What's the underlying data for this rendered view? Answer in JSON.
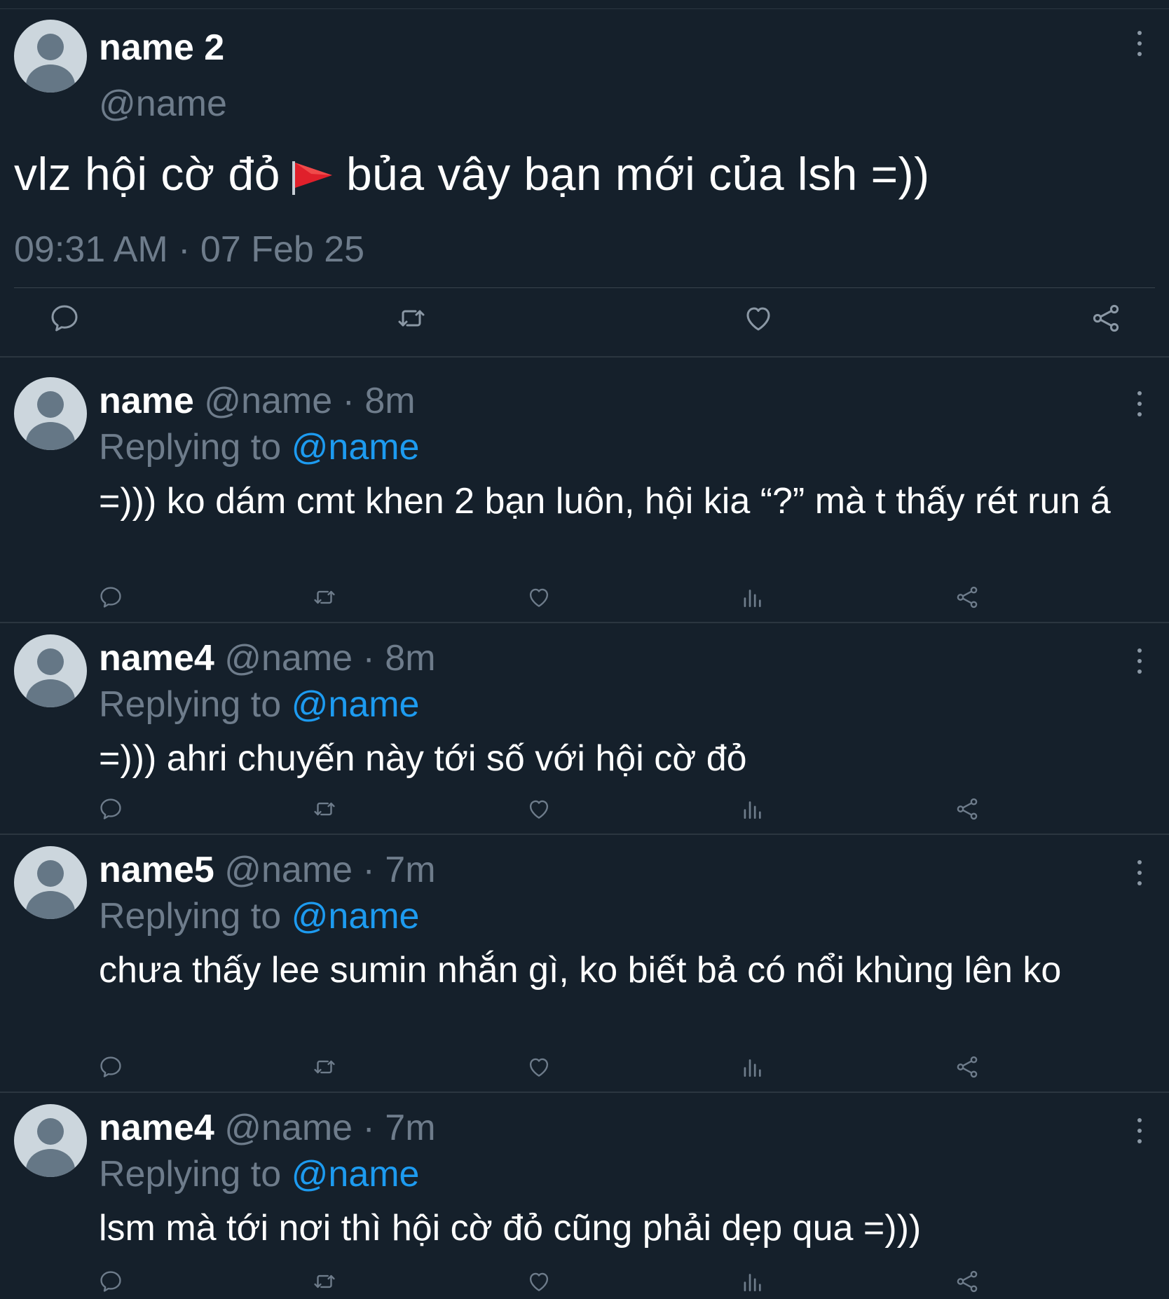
{
  "main_tweet": {
    "display_name": "name 2",
    "handle": "@name",
    "text_before_flag": "vlz hội cờ đỏ",
    "flag_emoji_name": "red-triangular-flag",
    "text_after_flag": "bủa vây bạn mới của lsh =))",
    "timestamp": "09:31 AM · 07 Feb 25",
    "actions": [
      "reply-icon",
      "retweet-icon",
      "like-icon",
      "share-icon"
    ]
  },
  "replies": [
    {
      "display_name": "name",
      "handle": "@name",
      "age": "· 8m",
      "replying_label": "Replying to",
      "replying_to": "@name",
      "text": "=))) ko dám cmt khen 2 bạn luôn, hội kia “?” mà t thấy rét run á"
    },
    {
      "display_name": "name4",
      "handle": "@name",
      "age": "· 8m",
      "replying_label": "Replying to",
      "replying_to": "@name",
      "text": "=))) ahri chuyến này tới số với hội cờ đỏ"
    },
    {
      "display_name": "name5",
      "handle": "@name",
      "age": "· 7m",
      "replying_label": "Replying to",
      "replying_to": "@name",
      "text": "chưa thấy lee sumin nhắn gì, ko biết bả có nổi khùng lên ko"
    },
    {
      "display_name": "name4",
      "handle": "@name",
      "age": "· 7m",
      "replying_label": "Replying to",
      "replying_to": "@name",
      "text": "lsm mà tới nơi thì hội cờ đỏ cũng phải dẹp qua =)))"
    }
  ],
  "reply_actions": [
    "reply-icon",
    "retweet-icon",
    "like-icon",
    "views-icon",
    "share-icon"
  ],
  "colors": {
    "background": "#15202b",
    "muted_text": "#6e7c8b",
    "mention": "#1d9bf0",
    "divider": "#2b3640"
  }
}
